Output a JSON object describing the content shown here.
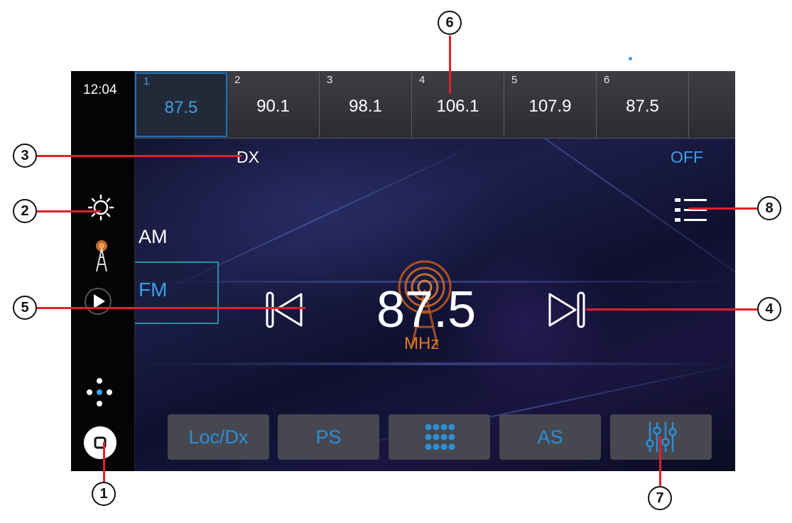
{
  "status": {
    "clock": "12:04"
  },
  "presets": [
    {
      "num": "1",
      "freq": "87.5",
      "active": true
    },
    {
      "num": "2",
      "freq": "90.1",
      "active": false
    },
    {
      "num": "3",
      "freq": "98.1",
      "active": false
    },
    {
      "num": "4",
      "freq": "106.1",
      "active": false
    },
    {
      "num": "5",
      "freq": "107.9",
      "active": false
    },
    {
      "num": "6",
      "freq": "87.5",
      "active": false
    }
  ],
  "tuner": {
    "dx_label": "DX",
    "off_label": "OFF",
    "band_am": "AM",
    "band_fm": "FM",
    "frequency": "87.5",
    "unit": "MHz"
  },
  "toolbar": {
    "loc_dx": "Loc/Dx",
    "ps": "PS",
    "as": "AS"
  },
  "callouts": {
    "c1": "1",
    "c2": "2",
    "c3": "3",
    "c4": "4",
    "c5": "5",
    "c6": "6",
    "c7": "7",
    "c8": "8"
  },
  "colors": {
    "accent_blue": "#3da0e6",
    "unit_orange": "#e07a22",
    "callout_line": "#e0202a"
  }
}
